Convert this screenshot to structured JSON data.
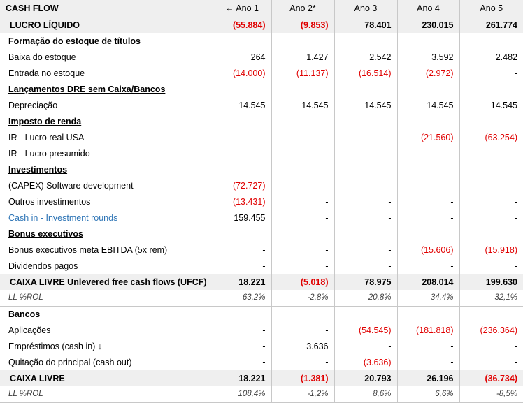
{
  "header": {
    "title": "CASH FLOW",
    "years": [
      "← Ano 1",
      "Ano 2*",
      "Ano 3",
      "Ano 4",
      "Ano 5"
    ]
  },
  "rows": [
    {
      "type": "bold",
      "label": "LUCRO LÍQUIDO",
      "values": [
        "(55.884)",
        "(9.853)",
        "78.401",
        "230.015",
        "261.774"
      ],
      "neg": [
        true,
        true,
        false,
        false,
        false
      ]
    },
    {
      "type": "section",
      "label": "Formação do estoque de títulos"
    },
    {
      "type": "item",
      "label": "Baixa do estoque",
      "values": [
        "264",
        "1.427",
        "2.542",
        "3.592",
        "2.482"
      ],
      "neg": [
        false,
        false,
        false,
        false,
        false
      ]
    },
    {
      "type": "item",
      "label": "Entrada no estoque",
      "values": [
        "(14.000)",
        "(11.137)",
        "(16.514)",
        "(2.972)",
        "-"
      ],
      "neg": [
        true,
        true,
        true,
        true,
        false
      ]
    },
    {
      "type": "section",
      "label": "Lançamentos DRE sem Caixa/Bancos"
    },
    {
      "type": "item",
      "label": "Depreciação",
      "values": [
        "14.545",
        "14.545",
        "14.545",
        "14.545",
        "14.545"
      ],
      "neg": [
        false,
        false,
        false,
        false,
        false
      ]
    },
    {
      "type": "section",
      "label": "Imposto de renda"
    },
    {
      "type": "item",
      "label": "IR - Lucro real USA",
      "values": [
        "-",
        "-",
        "-",
        "(21.560)",
        "(63.254)"
      ],
      "neg": [
        false,
        false,
        false,
        true,
        true
      ]
    },
    {
      "type": "item",
      "label": "IR - Lucro presumido",
      "values": [
        "-",
        "-",
        "-",
        "-",
        "-"
      ],
      "neg": [
        false,
        false,
        false,
        false,
        false
      ]
    },
    {
      "type": "section",
      "label": "Investimentos"
    },
    {
      "type": "item",
      "label": "(CAPEX) Software development",
      "values": [
        "(72.727)",
        "-",
        "-",
        "-",
        "-"
      ],
      "neg": [
        true,
        false,
        false,
        false,
        false
      ]
    },
    {
      "type": "item",
      "label": "Outros investimentos",
      "values": [
        "(13.431)",
        "-",
        "-",
        "-",
        "-"
      ],
      "neg": [
        true,
        false,
        false,
        false,
        false
      ]
    },
    {
      "type": "item",
      "label": "Cash in - Investment rounds",
      "link": true,
      "values": [
        "159.455",
        "-",
        "-",
        "-",
        "-"
      ],
      "neg": [
        false,
        false,
        false,
        false,
        false
      ]
    },
    {
      "type": "section",
      "label": "Bonus executivos"
    },
    {
      "type": "item",
      "label": "Bonus executivos meta EBITDA (5x rem)",
      "values": [
        "-",
        "-",
        "-",
        "(15.606)",
        "(15.918)"
      ],
      "neg": [
        false,
        false,
        false,
        true,
        true
      ]
    },
    {
      "type": "item",
      "label": "Dividendos pagos",
      "values": [
        "-",
        "-",
        "-",
        "-",
        "-"
      ],
      "neg": [
        false,
        false,
        false,
        false,
        false
      ]
    },
    {
      "type": "bold",
      "label": "CAIXA LIVRE Unlevered free cash flows (UFCF)",
      "values": [
        "18.221",
        "(5.018)",
        "78.975",
        "208.014",
        "199.630"
      ],
      "neg": [
        false,
        true,
        false,
        false,
        false
      ]
    },
    {
      "type": "pct",
      "label": "LL %ROL",
      "values": [
        "63,2%",
        "-2,8%",
        "20,8%",
        "34,4%",
        "32,1%"
      ],
      "neg": [
        false,
        false,
        false,
        false,
        false
      ]
    },
    {
      "type": "section",
      "label": "Bancos"
    },
    {
      "type": "item",
      "label": "Aplicações",
      "values": [
        "-",
        "-",
        "(54.545)",
        "(181.818)",
        "(236.364)"
      ],
      "neg": [
        false,
        false,
        true,
        true,
        true
      ]
    },
    {
      "type": "item",
      "label": "Empréstimos (cash in) ↓",
      "values": [
        "-",
        "3.636",
        "-",
        "-",
        "-"
      ],
      "neg": [
        false,
        false,
        false,
        false,
        false
      ]
    },
    {
      "type": "item",
      "label": "Quitação do principal (cash out)",
      "values": [
        "-",
        "-",
        "(3.636)",
        "-",
        "-"
      ],
      "neg": [
        false,
        false,
        true,
        false,
        false
      ]
    },
    {
      "type": "bold",
      "label": "CAIXA LIVRE",
      "values": [
        "18.221",
        "(1.381)",
        "20.793",
        "26.196",
        "(36.734)"
      ],
      "neg": [
        false,
        true,
        false,
        false,
        true
      ]
    },
    {
      "type": "pct",
      "label": "LL %ROL",
      "values": [
        "108,4%",
        "-1,2%",
        "8,6%",
        "6,6%",
        "-8,5%"
      ],
      "neg": [
        false,
        false,
        false,
        false,
        false
      ]
    }
  ],
  "colors": {
    "negative": "#e00000",
    "link": "#2e75b6",
    "header_bg": "#efefef"
  }
}
